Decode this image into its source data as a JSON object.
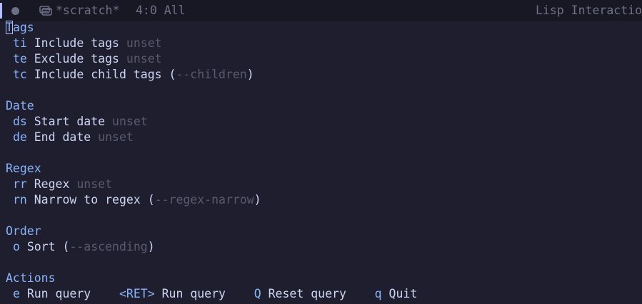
{
  "modeline": {
    "buffer_name": "*scratch*",
    "position": "4:0 All",
    "major_mode": "Lisp Interactio"
  },
  "sections": [
    {
      "title_first": "T",
      "title_rest": "ags",
      "items": [
        {
          "key": "ti",
          "label": "Include tags",
          "value": "unset"
        },
        {
          "key": "te",
          "label": "Exclude tags",
          "value": "unset"
        },
        {
          "key": "tc",
          "label": "Include child tags",
          "paren_open": "(",
          "flag": "--children",
          "paren_close": ")"
        }
      ]
    },
    {
      "title": "Date",
      "items": [
        {
          "key": "ds",
          "label": "Start date",
          "value": "unset"
        },
        {
          "key": "de",
          "label": "End date",
          "value": "unset"
        }
      ]
    },
    {
      "title": "Regex",
      "items": [
        {
          "key": "rr",
          "label": "Regex",
          "value": "unset"
        },
        {
          "key": "rn",
          "label": "Narrow to regex",
          "paren_open": "(",
          "flag": "--regex-narrow",
          "paren_close": ")"
        }
      ]
    },
    {
      "title": "Order",
      "items": [
        {
          "key": "o",
          "label": "Sort",
          "paren_open": "(",
          "flag": "--ascending",
          "paren_close": ")"
        }
      ]
    },
    {
      "title": "Actions",
      "actions": [
        {
          "key": "e",
          "label": "Run query"
        },
        {
          "key": "<RET>",
          "label": "Run query"
        },
        {
          "key": "Q",
          "label": "Reset query"
        },
        {
          "key": "q",
          "label": "Quit"
        }
      ]
    }
  ]
}
